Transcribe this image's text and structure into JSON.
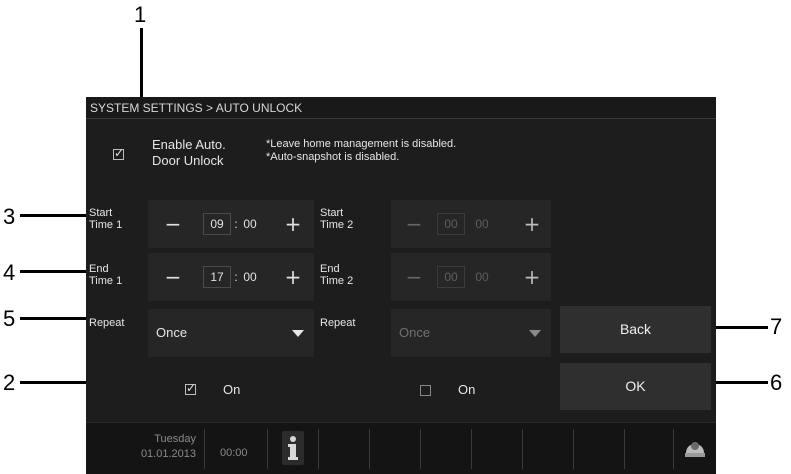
{
  "callouts": [
    "1",
    "2",
    "3",
    "4",
    "5",
    "6",
    "7"
  ],
  "breadcrumb": "SYSTEM SETTINGS > AUTO UNLOCK",
  "enable": {
    "label_line1": "Enable Auto.",
    "label_line2": "Door Unlock",
    "checked": true
  },
  "notes": [
    "*Leave home management is disabled.",
    "*Auto-snapshot is disabled."
  ],
  "schedule1": {
    "start_label": [
      "Start",
      "Time 1"
    ],
    "start_hour": "09",
    "start_min": "00",
    "end_label": [
      "End",
      "Time 1"
    ],
    "end_hour": "17",
    "end_min": "00",
    "repeat_label": "Repeat",
    "repeat_value": "Once",
    "on_label": "On",
    "on_checked": true
  },
  "schedule2": {
    "start_label": [
      "Start",
      "Time 2"
    ],
    "start_hour": "00",
    "start_min": "00",
    "end_label": [
      "End",
      "Time 2"
    ],
    "end_hour": "00",
    "end_min": "00",
    "repeat_label": "Repeat",
    "repeat_value": "Once",
    "on_label": "On",
    "on_checked": false
  },
  "stepper": {
    "minus": "−",
    "plus": "+",
    "colon": ":"
  },
  "buttons": {
    "back": "Back",
    "ok": "OK"
  },
  "status": {
    "day": "Tuesday",
    "date": "01.01.2013",
    "time": "00:00"
  },
  "icons": [
    "info-icon",
    "intercom-icon",
    "chevron-down-icon",
    "checkmark-icon"
  ],
  "colors": {
    "screen_bg": "#1d1d1d",
    "panel_bg": "#262626",
    "button_bg": "#2f2f2f",
    "text": "#e6e6e6"
  }
}
